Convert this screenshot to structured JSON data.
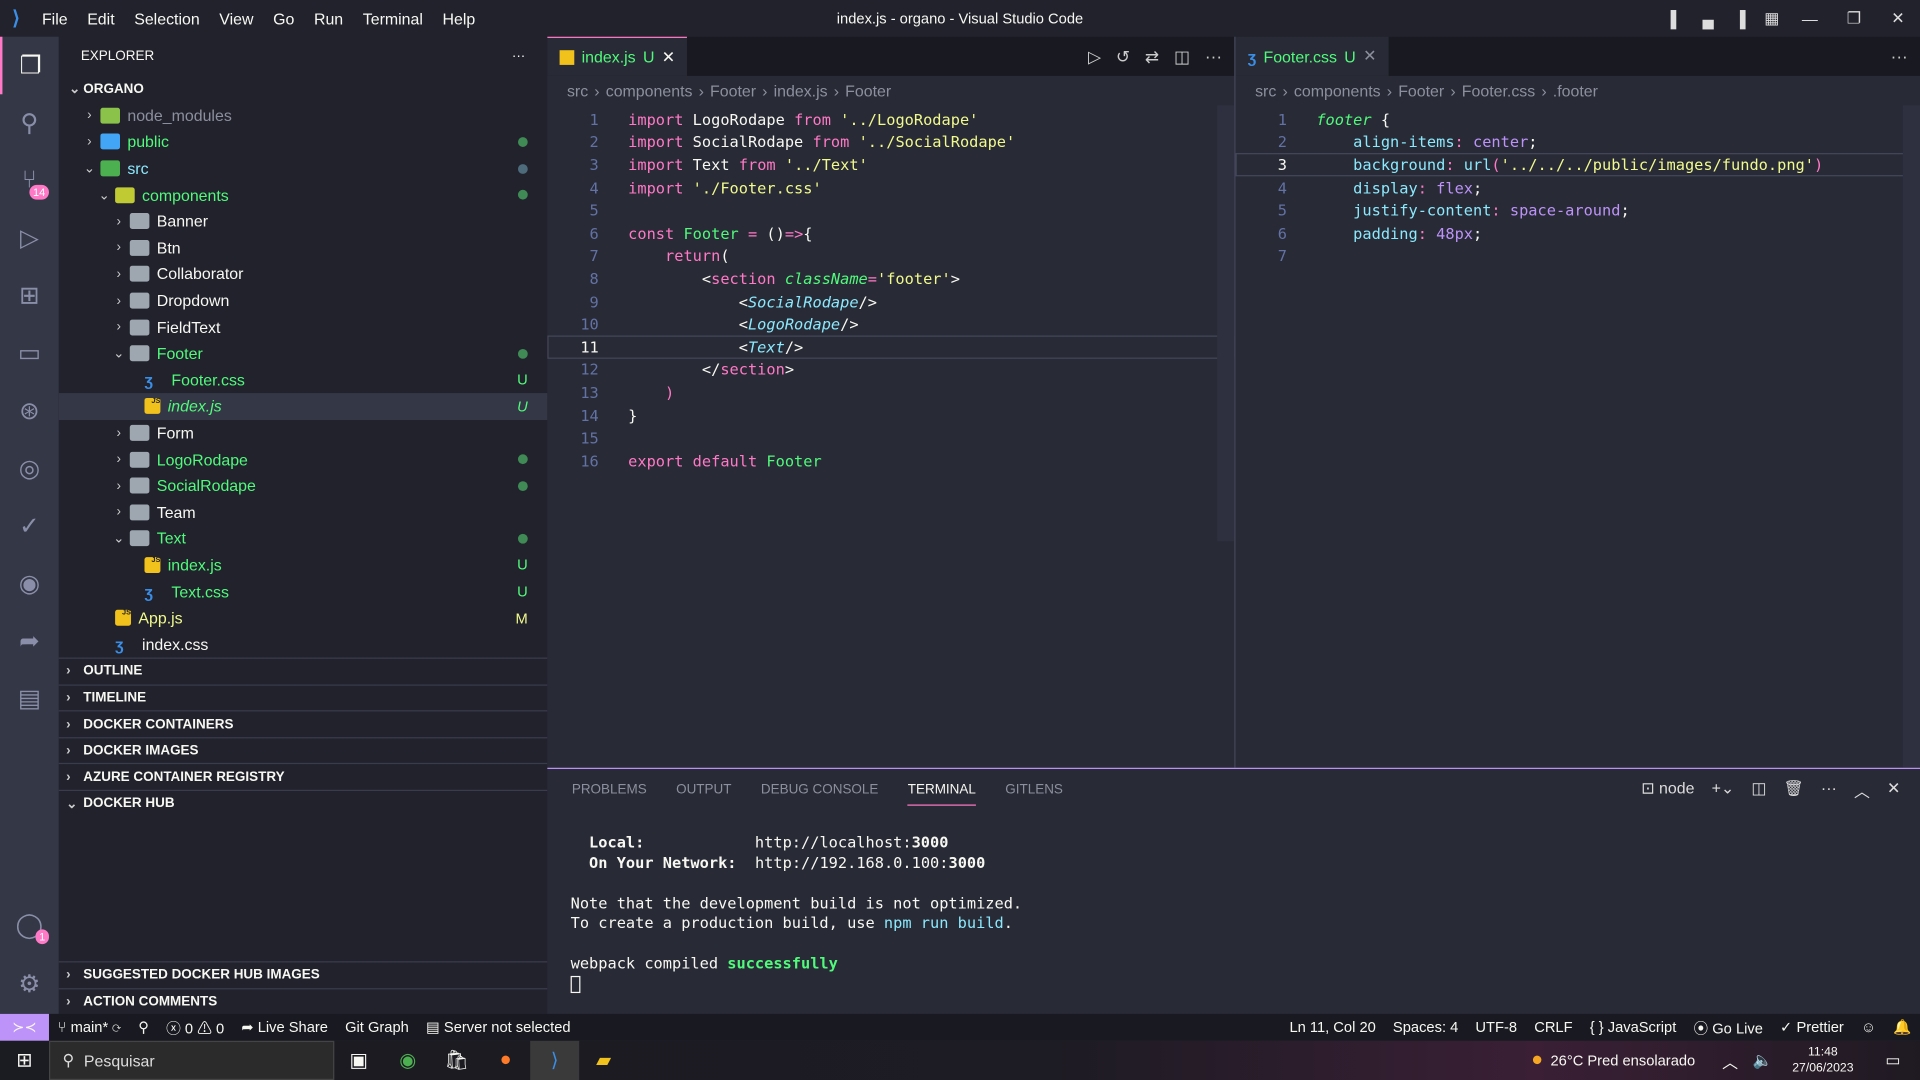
{
  "titlebar": {
    "menu": [
      "File",
      "Edit",
      "Selection",
      "View",
      "Go",
      "Run",
      "Terminal",
      "Help"
    ],
    "title": "index.js - organo - Visual Studio Code"
  },
  "activity": {
    "scm_badge": "14",
    "accounts_badge": "1"
  },
  "sidebar": {
    "header": "EXPLORER",
    "root": "ORGANO",
    "tree": [
      {
        "label": "node_modules",
        "depth": 1,
        "kind": "folder",
        "open": false,
        "color": "gray",
        "status": ""
      },
      {
        "label": "public",
        "depth": 1,
        "kind": "folder",
        "open": false,
        "color": "green",
        "status": "dot"
      },
      {
        "label": "src",
        "depth": 1,
        "kind": "folder",
        "open": true,
        "color": "cyan",
        "status": "dot"
      },
      {
        "label": "components",
        "depth": 2,
        "kind": "folder",
        "open": true,
        "color": "green",
        "status": "dot"
      },
      {
        "label": "Banner",
        "depth": 3,
        "kind": "folder",
        "open": false,
        "color": "white",
        "status": ""
      },
      {
        "label": "Btn",
        "depth": 3,
        "kind": "folder",
        "open": false,
        "color": "white",
        "status": ""
      },
      {
        "label": "Collaborator",
        "depth": 3,
        "kind": "folder",
        "open": false,
        "color": "white",
        "status": ""
      },
      {
        "label": "Dropdown",
        "depth": 3,
        "kind": "folder",
        "open": false,
        "color": "white",
        "status": ""
      },
      {
        "label": "FieldText",
        "depth": 3,
        "kind": "folder",
        "open": false,
        "color": "white",
        "status": ""
      },
      {
        "label": "Footer",
        "depth": 3,
        "kind": "folder",
        "open": true,
        "color": "green",
        "status": "dot"
      },
      {
        "label": "Footer.css",
        "depth": 4,
        "kind": "css",
        "color": "green",
        "status": "U"
      },
      {
        "label": "index.js",
        "depth": 4,
        "kind": "js",
        "color": "green",
        "status": "U",
        "selected": true
      },
      {
        "label": "Form",
        "depth": 3,
        "kind": "folder",
        "open": false,
        "color": "white",
        "status": ""
      },
      {
        "label": "LogoRodape",
        "depth": 3,
        "kind": "folder",
        "open": false,
        "color": "green",
        "status": "dot"
      },
      {
        "label": "SocialRodape",
        "depth": 3,
        "kind": "folder",
        "open": false,
        "color": "green",
        "status": "dot"
      },
      {
        "label": "Team",
        "depth": 3,
        "kind": "folder",
        "open": false,
        "color": "white",
        "status": ""
      },
      {
        "label": "Text",
        "depth": 3,
        "kind": "folder",
        "open": true,
        "color": "green",
        "status": "dot"
      },
      {
        "label": "index.js",
        "depth": 4,
        "kind": "js",
        "color": "green",
        "status": "U"
      },
      {
        "label": "Text.css",
        "depth": 4,
        "kind": "css",
        "color": "green",
        "status": "U"
      },
      {
        "label": "App.js",
        "depth": 2,
        "kind": "js",
        "color": "yellow",
        "status": "M"
      },
      {
        "label": "index.css",
        "depth": 2,
        "kind": "css",
        "color": "white",
        "status": ""
      }
    ],
    "sections": [
      {
        "label": "OUTLINE",
        "open": false
      },
      {
        "label": "TIMELINE",
        "open": false
      },
      {
        "label": "DOCKER CONTAINERS",
        "open": false
      },
      {
        "label": "DOCKER IMAGES",
        "open": false
      },
      {
        "label": "AZURE CONTAINER REGISTRY",
        "open": false
      },
      {
        "label": "DOCKER HUB",
        "open": true
      }
    ],
    "bottom_sections": [
      {
        "label": "SUGGESTED DOCKER HUB IMAGES"
      },
      {
        "label": "ACTION COMMENTS"
      }
    ]
  },
  "editor1": {
    "tab": {
      "name": "index.js",
      "status": "U"
    },
    "breadcrumb": [
      "src",
      "components",
      "Footer",
      "index.js",
      "Footer"
    ],
    "cursor_line": 11,
    "lines": [
      [
        [
          "import ",
          "kw"
        ],
        [
          "LogoRodape ",
          "pl"
        ],
        [
          "from ",
          "kw"
        ],
        [
          "'../LogoRodape'",
          "str"
        ]
      ],
      [
        [
          "import ",
          "kw"
        ],
        [
          "SocialRodape ",
          "pl"
        ],
        [
          "from ",
          "kw"
        ],
        [
          "'../SocialRodape'",
          "str"
        ]
      ],
      [
        [
          "import ",
          "kw"
        ],
        [
          "Text ",
          "pl"
        ],
        [
          "from ",
          "kw"
        ],
        [
          "'../Text'",
          "str"
        ]
      ],
      [
        [
          "import ",
          "kw"
        ],
        [
          "'./Footer.css'",
          "str"
        ]
      ],
      [],
      [
        [
          "const ",
          "kw"
        ],
        [
          "Footer ",
          "fn"
        ],
        [
          "= ",
          "kw"
        ],
        [
          "()",
          "pl"
        ],
        [
          "=>",
          "kw"
        ],
        [
          "{",
          "pl"
        ]
      ],
      [
        [
          "    return",
          "kw"
        ],
        [
          "(",
          "pl"
        ]
      ],
      [
        [
          "        <",
          "pl"
        ],
        [
          "section ",
          "tag"
        ],
        [
          "className",
          "attr"
        ],
        [
          "=",
          "kw"
        ],
        [
          "'footer'",
          "str"
        ],
        [
          ">",
          "pl"
        ]
      ],
      [
        [
          "            <",
          "pl"
        ],
        [
          "SocialRodape",
          "comp"
        ],
        [
          "/>",
          "pl"
        ]
      ],
      [
        [
          "            <",
          "pl"
        ],
        [
          "LogoRodape",
          "comp"
        ],
        [
          "/>",
          "pl"
        ]
      ],
      [
        [
          "            <",
          "pl"
        ],
        [
          "Text",
          "comp"
        ],
        [
          "/>",
          "pl"
        ]
      ],
      [
        [
          "        </",
          "pl"
        ],
        [
          "section",
          "tag"
        ],
        [
          ">",
          "pl"
        ]
      ],
      [
        [
          "    )",
          "kw"
        ]
      ],
      [
        [
          "}",
          "pl"
        ]
      ],
      [],
      [
        [
          "export ",
          "kw"
        ],
        [
          "default ",
          "kw"
        ],
        [
          "Footer",
          "fn"
        ]
      ]
    ]
  },
  "editor2": {
    "tab": {
      "name": "Footer.css",
      "status": "U"
    },
    "breadcrumb": [
      "src",
      "components",
      "Footer",
      "Footer.css",
      ".footer"
    ],
    "cursor_line": 3,
    "lines": [
      [
        [
          "footer ",
          "sel"
        ],
        [
          "{",
          "pl"
        ]
      ],
      [
        [
          "    align-items",
          "prop"
        ],
        [
          ": ",
          "kw"
        ],
        [
          "center",
          "val"
        ],
        [
          ";",
          "pl"
        ]
      ],
      [
        [
          "    background",
          "prop"
        ],
        [
          ": ",
          "kw"
        ],
        [
          "url",
          "prop"
        ],
        [
          "(",
          "kw"
        ],
        [
          "'../../../public/images/fundo.png'",
          "str"
        ],
        [
          ")",
          "kw"
        ]
      ],
      [
        [
          "    display",
          "prop"
        ],
        [
          ": ",
          "kw"
        ],
        [
          "flex",
          "val"
        ],
        [
          ";",
          "pl"
        ]
      ],
      [
        [
          "    justify-content",
          "prop"
        ],
        [
          ": ",
          "kw"
        ],
        [
          "space-around",
          "val"
        ],
        [
          ";",
          "pl"
        ]
      ],
      [
        [
          "    padding",
          "prop"
        ],
        [
          ": ",
          "kw"
        ],
        [
          "48px",
          "val"
        ],
        [
          ";",
          "pl"
        ]
      ],
      []
    ]
  },
  "panel": {
    "tabs": [
      "PROBLEMS",
      "OUTPUT",
      "DEBUG CONSOLE",
      "TERMINAL",
      "GITLENS"
    ],
    "active": "TERMINAL",
    "terminal_name": "node",
    "terminal": {
      "local_label": "Local:",
      "local_url": "http://localhost:",
      "local_port": "3000",
      "net_label": "On Your Network:",
      "net_url": "http://192.168.0.100:",
      "net_port": "3000",
      "note1": "Note that the development build is not optimized.",
      "note2a": "To create a production build, use ",
      "note2b": "npm run build",
      "note2c": ".",
      "compiled_a": "webpack compiled ",
      "compiled_b": "successfully"
    }
  },
  "status": {
    "branch": "main*",
    "errors": "0",
    "warnings": "0",
    "live_share": "Live Share",
    "git_graph": "Git Graph",
    "server": "Server not selected",
    "position": "Ln 11, Col 20",
    "spaces": "Spaces: 4",
    "encoding": "UTF-8",
    "eol": "CRLF",
    "language": "JavaScript",
    "go_live": "Go Live",
    "prettier": "Prettier"
  },
  "taskbar": {
    "search_placeholder": "Pesquisar",
    "weather": "26°C  Pred ensolarado",
    "time": "11:48",
    "date": "27/06/2023"
  },
  "colors": {
    "accent": "#ff79c6",
    "remote": "#bd93f9",
    "added": "#50fa7b"
  }
}
